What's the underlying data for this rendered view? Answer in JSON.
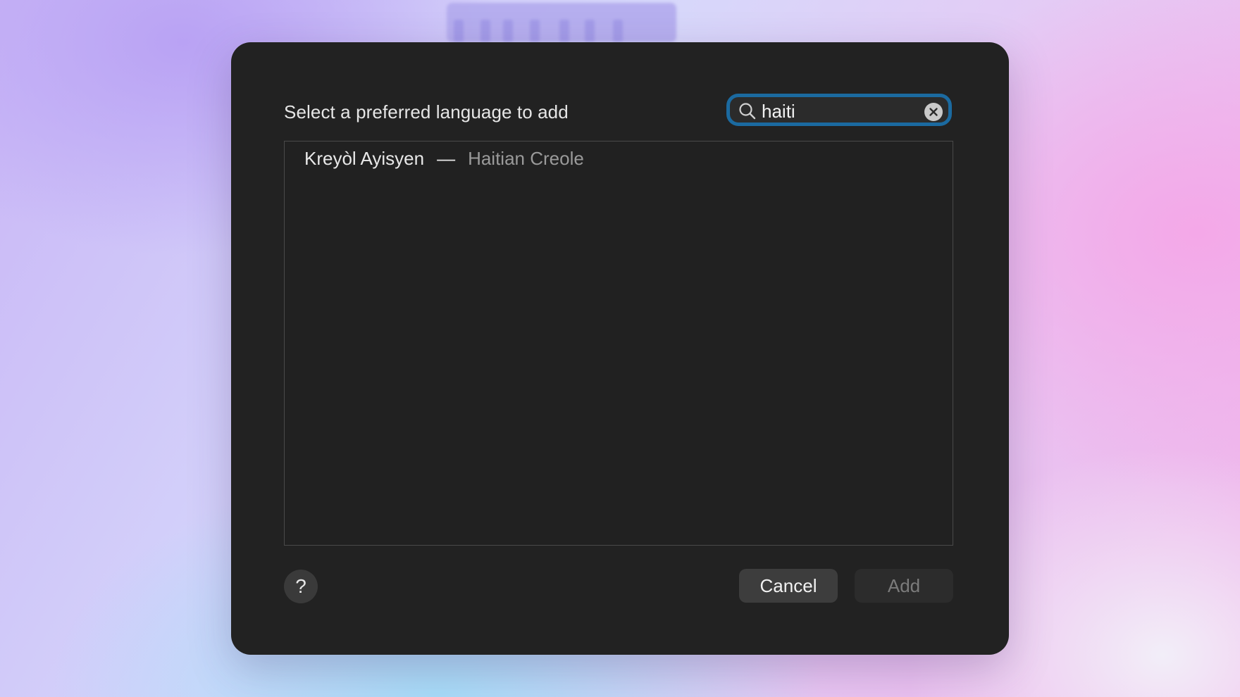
{
  "dialog": {
    "title": "Select a preferred language to add"
  },
  "search": {
    "value": "haiti",
    "icon": "magnifying-glass",
    "clear_icon": "circle-x",
    "focus_ring_color": "#1b6aa0"
  },
  "results": [
    {
      "native_name": "Kreyòl Ayisyen",
      "separator": "—",
      "english_name": "Haitian Creole"
    }
  ],
  "footer": {
    "help_label": "?",
    "cancel_label": "Cancel",
    "add_label": "Add",
    "add_enabled": false
  }
}
